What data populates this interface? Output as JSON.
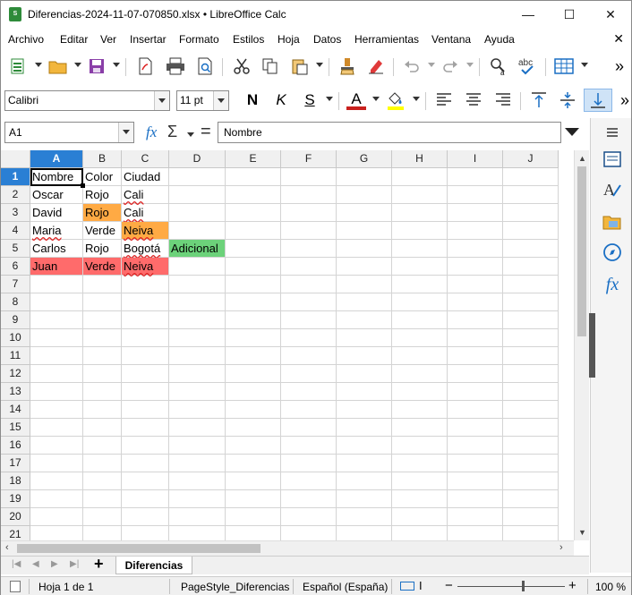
{
  "window": {
    "title": "Diferencias-2024-11-07-070850.xlsx • LibreOffice Calc",
    "icon_text": "S",
    "controls": {
      "minimize": "—",
      "maximize": "☐",
      "close": "✕"
    }
  },
  "menu": {
    "items": [
      "Archivo",
      "Editar",
      "Ver",
      "Insertar",
      "Formato",
      "Estilos",
      "Hoja",
      "Datos",
      "Herramientas",
      "Ventana",
      "Ayuda"
    ],
    "close": "✕"
  },
  "toolbar2": {
    "font_name": "Calibri",
    "font_size": "11 pt",
    "bold": "N",
    "italic": "K",
    "underline": "S",
    "font_color_letter": "A"
  },
  "formula_bar": {
    "cell_ref": "A1",
    "fx_label": "fx",
    "sum_label": "Σ",
    "eq_label": "=",
    "content": "Nombre"
  },
  "sheet": {
    "columns": [
      "A",
      "B",
      "C",
      "D",
      "E",
      "F",
      "G",
      "H",
      "I",
      "J"
    ],
    "rows": [
      "1",
      "2",
      "3",
      "4",
      "5",
      "6",
      "7",
      "8",
      "9",
      "10",
      "11",
      "12",
      "13",
      "14",
      "15",
      "16",
      "17",
      "18",
      "19",
      "20",
      "21"
    ],
    "cells": {
      "A1": "Nombre",
      "B1": "Color",
      "C1": "Ciudad",
      "A2": "Oscar",
      "B2": "Rojo",
      "C2": "Cali",
      "A3": "David",
      "B3": "Rojo",
      "C3": "Cali",
      "A4": "Maria",
      "B4": "Verde",
      "C4": "Neiva",
      "A5": "Carlos",
      "B5": "Rojo",
      "C5": "Bogotá",
      "D5": "Adicional",
      "A6": "Juan",
      "B6": "Verde",
      "C6": "Neiva"
    },
    "colors": {
      "orange": "#ffaa44",
      "green": "#6cd27a",
      "red": "#ff6b6b",
      "selection": "#2a7fd4"
    }
  },
  "tabs": {
    "add_label": "+",
    "sheet_name": "Diferencias"
  },
  "status": {
    "sheet_info": "Hoja 1 de 1",
    "page_style": "PageStyle_Diferencias",
    "language": "Español (España)",
    "zoom_minus": "−",
    "zoom_plus": "+",
    "zoom": "100 %"
  }
}
